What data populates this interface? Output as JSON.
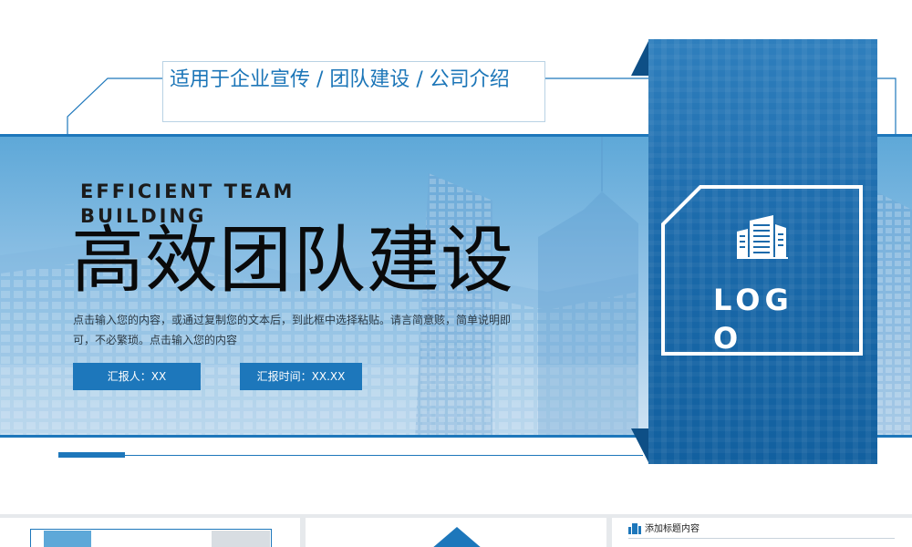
{
  "slide": {
    "subtitle": "适用于企业宣传 / 团队建设 / 公司介绍",
    "title_en": "EFFICIENT TEAM BUILDING",
    "title_cn": "高效团队建设",
    "description": "点击输入您的内容，或通过复制您的文本后，到此框中选择粘贴。请言简意赅，简单说明即可，不必繁琐。点击输入您的内容",
    "reporter_label": "汇报人：XX",
    "time_label": "汇报时间：XX.XX",
    "logo_text": "LOGO",
    "logo_icon": "building-icon"
  },
  "thumbnails": [
    {
      "label": ""
    },
    {
      "label": ""
    },
    {
      "label": "添加标题内容",
      "icon": "building-icon"
    }
  ],
  "colors": {
    "accent": "#1d77bb",
    "banner_light": "#cfe3f3",
    "panel_dark": "#12609f"
  }
}
